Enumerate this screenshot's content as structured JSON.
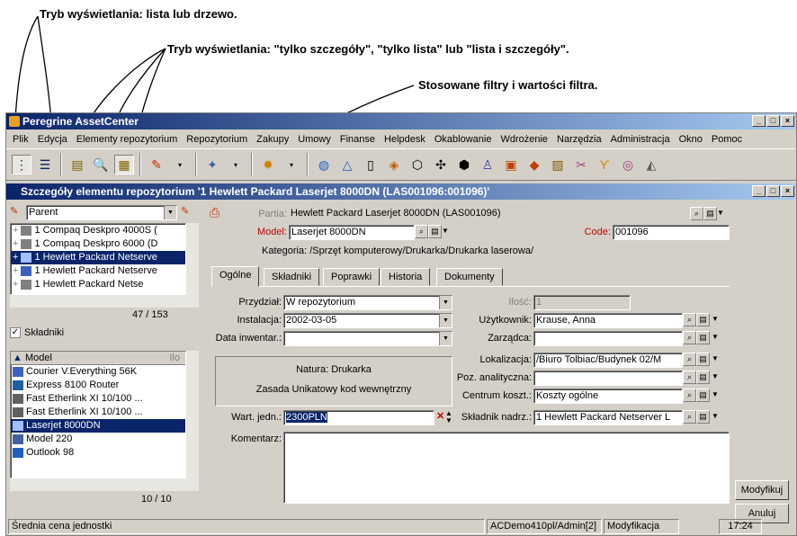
{
  "annotations": {
    "a1": "Tryb wyświetlania: lista lub drzewo.",
    "a2": "Tryb wyświetlania: \"tylko szczegóły\", \"tylko  lista\" lub \"lista i szczegóły\".",
    "a3": "Stosowane filtry i wartości filtra."
  },
  "app": {
    "title": "Peregrine AssetCenter",
    "menu": [
      "Plik",
      "Edycja",
      "Elementy repozytorium",
      "Repozytorium",
      "Zakupy",
      "Umowy",
      "Finanse",
      "Helpdesk",
      "Okablowanie",
      "Wdrożenie",
      "Narzędzia",
      "Administracja",
      "Okno",
      "Pomoc"
    ],
    "window_controls": {
      "min": "_",
      "max": "□",
      "close": "×"
    }
  },
  "detail_window": {
    "title": "Szczegóły elementu repozytorium '1 Hewlett Packard Laserjet 8000DN (LAS001096:001096)'"
  },
  "left_panel": {
    "filter_combo": "Parent",
    "tree_items": [
      "1 Compaq Deskpro 4000S (",
      "1 Compaq Deskpro 6000 (D",
      "1 Hewlett Packard Netserve",
      "1 Hewlett Packard Netserve",
      "1 Hewlett Packard Netse"
    ],
    "tree_count": "47 / 153",
    "checkbox_label": "Składniki",
    "list_header_left": "Model",
    "list_header_right": "Ilo",
    "list_items": [
      "Courier V.Everything 56K",
      "Express 8100 Router",
      "Fast Etherlink XI 10/100 ...",
      "Fast Etherlink XI 10/100 ...",
      "Laserjet 8000DN",
      "Model 220",
      "Outlook 98"
    ],
    "list_count": "10 / 10"
  },
  "form": {
    "partia_label": "Partia:",
    "partia_value": "Hewlett Packard Laserjet 8000DN (LAS001096)",
    "model_label": "Model:",
    "model_value": "Laserjet 8000DN",
    "code_label": "Code:",
    "code_value": "001096",
    "kategoria": "Kategoria: /Sprzęt komputerowy/Drukarka/Drukarka laserowa/",
    "tabs": [
      "Ogólne",
      "Składniki",
      "Poprawki",
      "Historia",
      "Dokumenty"
    ],
    "przydzial_label": "Przydział:",
    "przydzial_value": "W repozytorium",
    "instalacja_label": "Instalacja:",
    "instalacja_value": "2002-03-05",
    "data_inw_label": "Data inwentar.:",
    "data_inw_value": "",
    "ilosc_label": "Ilość:",
    "ilosc_value": "1",
    "uzytkownik_label": "Użytkownik:",
    "uzytkownik_value": "Krause, Anna",
    "zarzadca_label": "Zarządca:",
    "zarzadca_value": "",
    "natura": "Natura: Drukarka",
    "zasada": "Zasada Unikatowy kod wewnętrzny",
    "lokalizacja_label": "Lokalizacja:",
    "lokalizacja_value": "/Biuro Tolbiac/Budynek 02/M",
    "poz_label": "Poz. analityczna:",
    "poz_value": "",
    "centrum_label": "Centrum koszt.:",
    "centrum_value": "Koszty ogólne",
    "wart_label": "Wart. jedn.:",
    "wart_value": "2300PLN",
    "skladnik_label": "Składnik nadrz.:",
    "skladnik_value": "1 Hewlett Packard Netserver L",
    "komentarz_label": "Komentarz:",
    "komentarz_value": ""
  },
  "buttons": {
    "modify": "Modyfikuj",
    "cancel": "Anuluj"
  },
  "status": {
    "hint": "Średnia cena jednostki",
    "db": "ACDemo410pl/Admin[2]",
    "mode": "Modyfikacja",
    "time": "17:24"
  }
}
